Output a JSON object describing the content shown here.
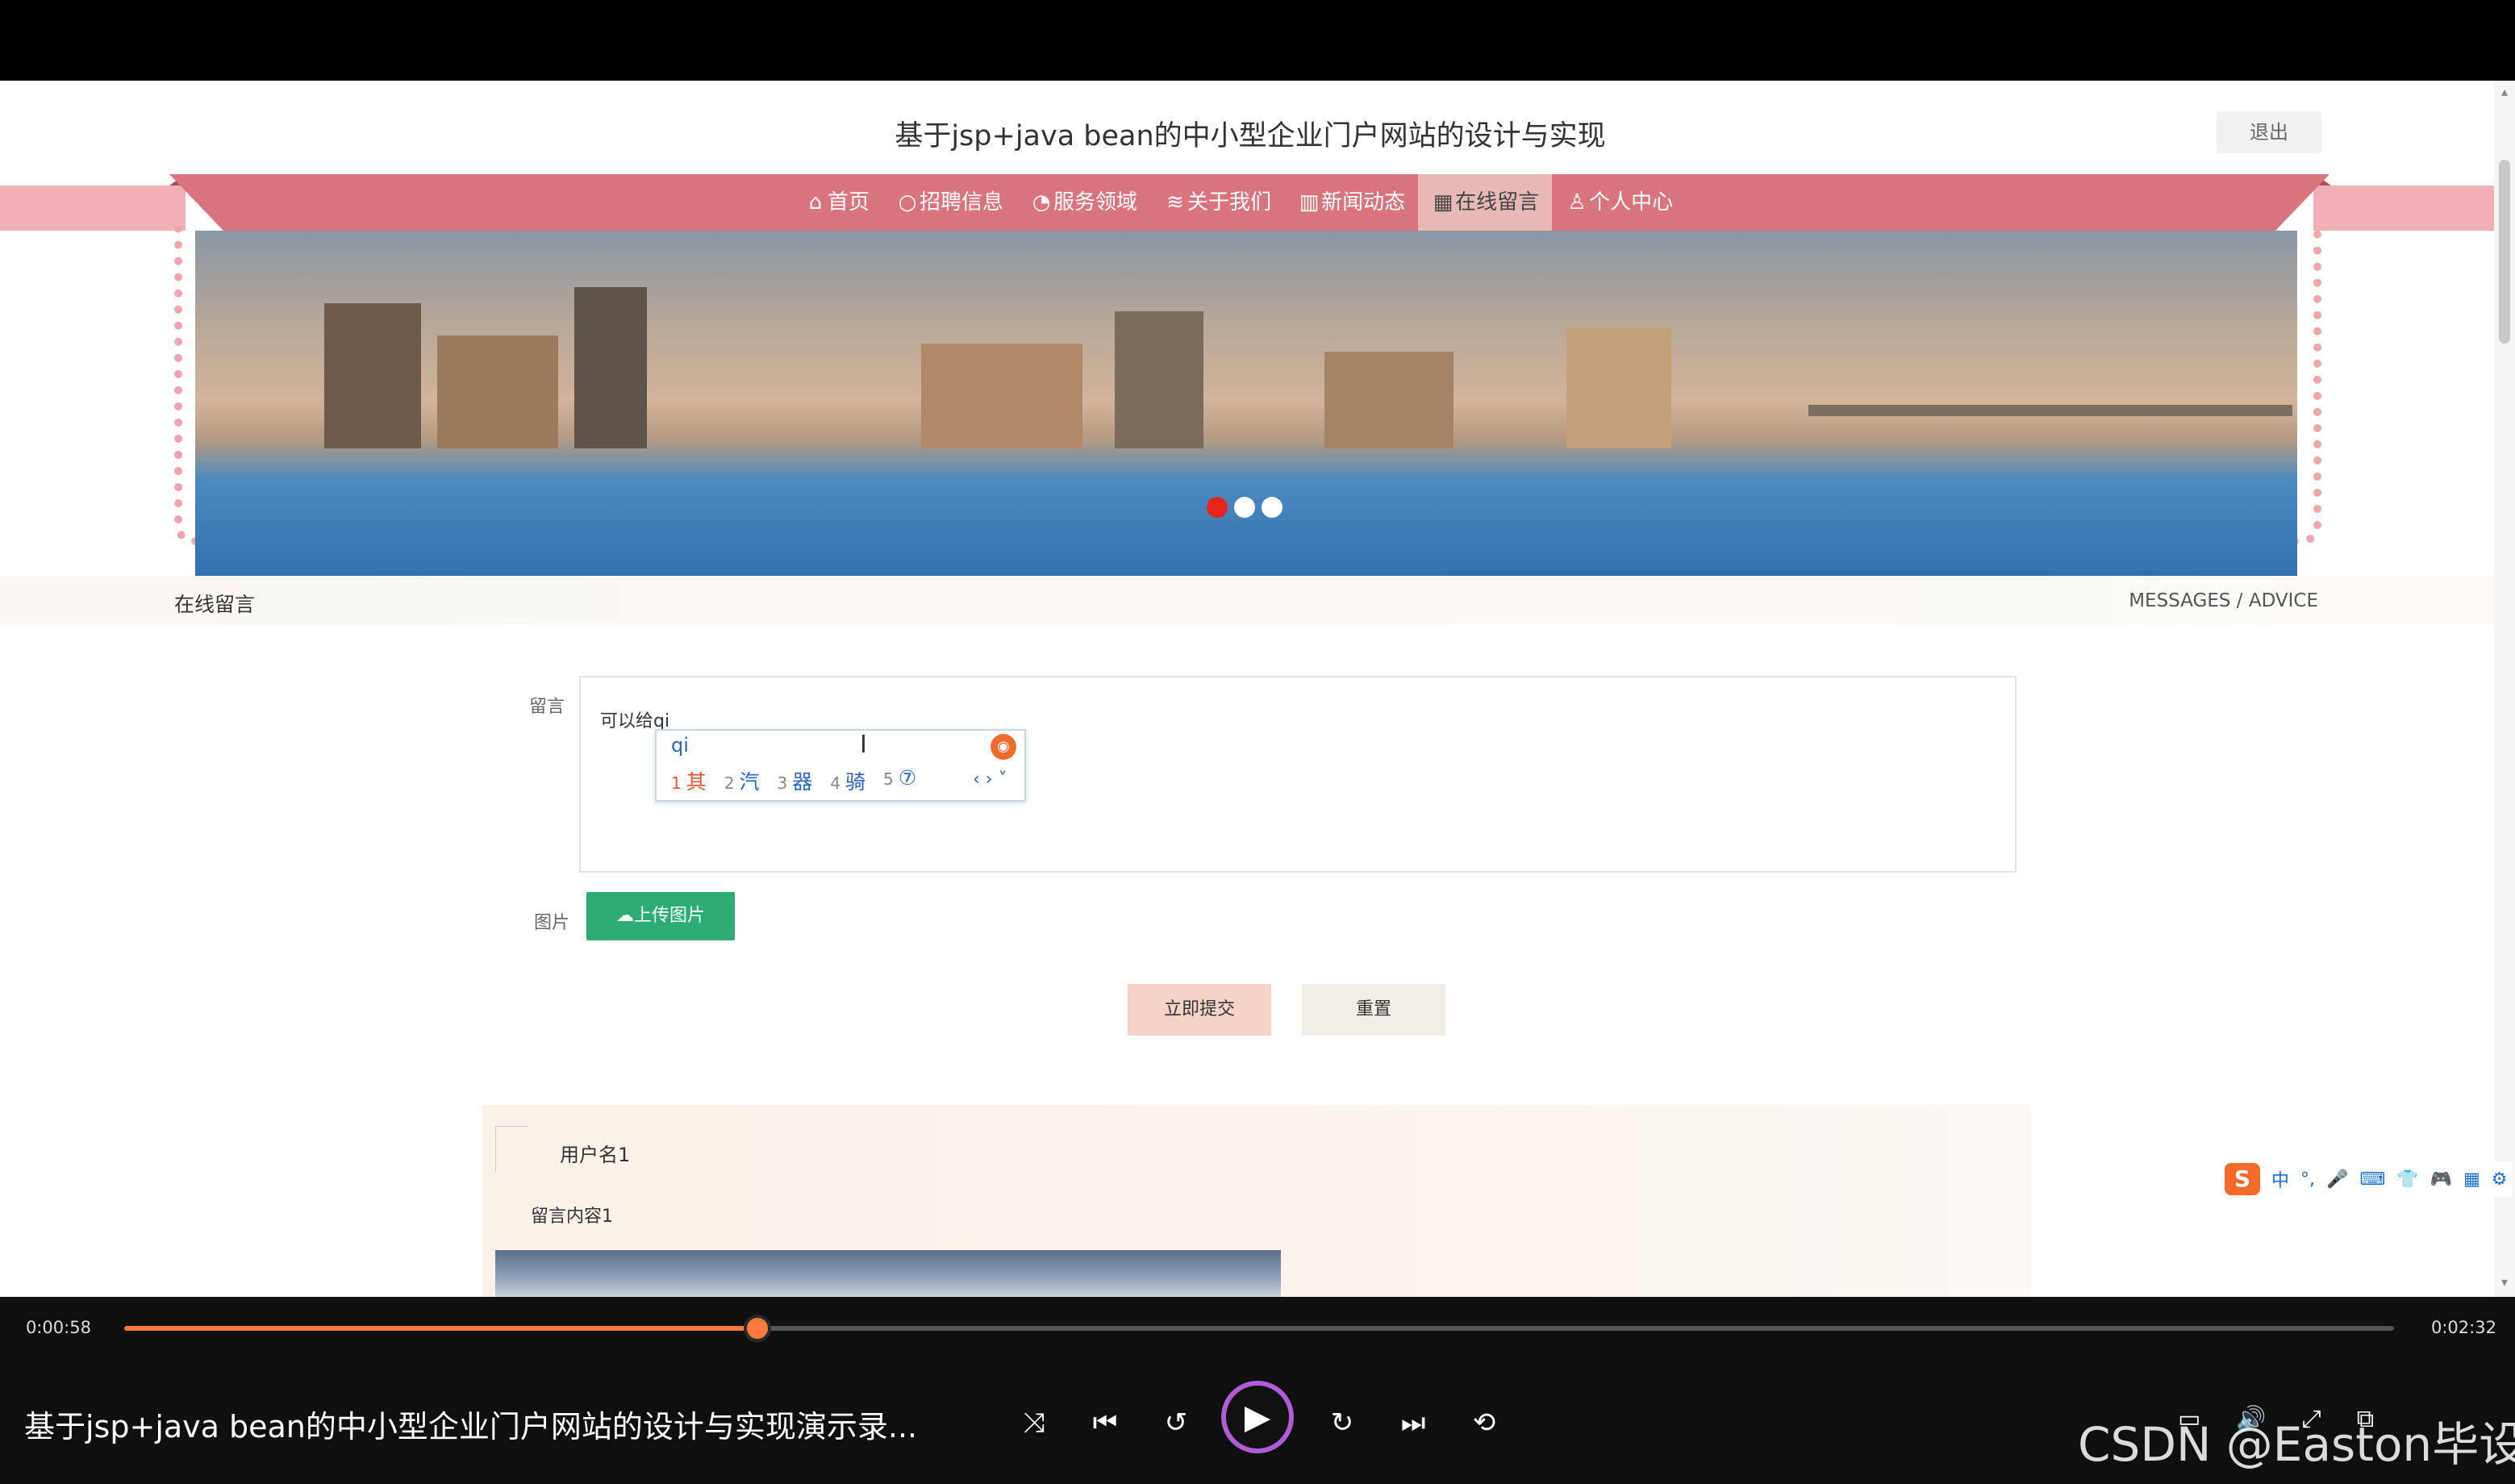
{
  "site": {
    "title": "基于jsp+java bean的中小型企业门户网站的设计与实现",
    "logout_label": "退出"
  },
  "nav": {
    "items": [
      {
        "icon": "home-icon",
        "glyph": "⌂",
        "label": "首页"
      },
      {
        "icon": "circle-icon",
        "glyph": "○",
        "label": "招聘信息"
      },
      {
        "icon": "gauge-icon",
        "glyph": "◔",
        "label": "服务领域"
      },
      {
        "icon": "sliders-icon",
        "glyph": "≋",
        "label": "关于我们"
      },
      {
        "icon": "building-icon",
        "glyph": "▥",
        "label": "新闻动态"
      },
      {
        "icon": "calendar-icon",
        "glyph": "▦",
        "label": "在线留言"
      },
      {
        "icon": "user-icon",
        "glyph": "♙",
        "label": "个人中心"
      }
    ],
    "active": "在线留言"
  },
  "banner": {
    "dots": 3,
    "active_dot": 1
  },
  "section": {
    "title": "在线留言",
    "subtitle": "MESSAGES / ADVICE"
  },
  "form": {
    "message_label": "留言",
    "message_value": "可以给qi",
    "image_label": "图片",
    "upload_label": "上传图片",
    "submit_label": "立即提交",
    "reset_label": "重置"
  },
  "ime": {
    "input": "qi",
    "candidates": [
      {
        "n": "1",
        "text": "其"
      },
      {
        "n": "2",
        "text": "汽"
      },
      {
        "n": "3",
        "text": "器"
      },
      {
        "n": "4",
        "text": "骑"
      },
      {
        "n": "5",
        "text": "⑦"
      }
    ],
    "toolbar": [
      "中",
      "°,",
      "🎤",
      "⌨",
      "👕",
      "🎮",
      "▦",
      "⚙"
    ]
  },
  "comment": {
    "username": "用户名1",
    "content": "留言内容1"
  },
  "player": {
    "current_time": "0:00:58",
    "total_time": "0:02:32",
    "progress": 0.2788,
    "video_title": "基于jsp+java bean的中小型企业门户网站的设计与实现演示录...",
    "watermark": "CSDN @Easton毕设"
  },
  "colors": {
    "nav_bg": "#d7747d",
    "ribbon": "#f0aeb5",
    "upload": "#2dad75",
    "progress": "#ff7a3d",
    "play_ring": "#b05cd8"
  }
}
